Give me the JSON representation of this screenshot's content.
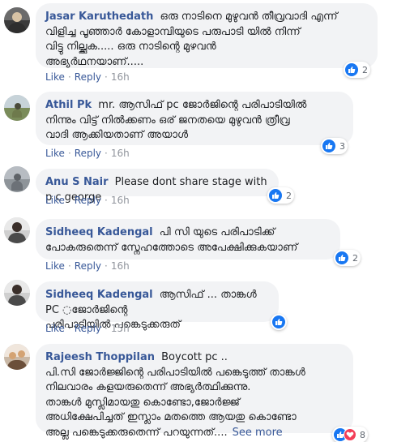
{
  "comments": [
    {
      "author": "Jasar Karuthedath",
      "text": "ഒരു നാടിനെ മുഴുവൻ തീവ്രവാദി എന്ന്\nവിളിച്ച പൂഞ്ഞാർ കോളാമ്പിയുടെ പരുപാടി യിൽ നിന്ന്\nവിട്ടു നില്ക്കുക..... ഒരു നാടിന്റെ മുഴവൻ\nഅഭ്യർഥനയാണ്.....",
      "reactions": [
        "like"
      ],
      "reaction_count": "2",
      "like_label": "Like",
      "reply_label": "Reply",
      "time": "16h",
      "avatar_colors": [
        "#6b6b6b",
        "#3b3b3b",
        "#d8c3a5",
        "#2e2e2e"
      ]
    },
    {
      "author": "Athil Pk",
      "text": "mr. ആസിഫ് pc ജോർജിന്റെ പരിപാടിയിൽ\nനിന്നും വിട്ട് നിൽക്കണം ഒര് ജനതയെ മുഴുവൻ ത്രീവ്ര\nവാദി ആക്കിയതാണ് അയാൾ",
      "reactions": [
        "like"
      ],
      "reaction_count": "3",
      "like_label": "Like",
      "reply_label": "Reply",
      "time": "16h",
      "avatar_colors": [
        "#c7d3d9",
        "#7a8c5a",
        "#4a4a3a",
        "#6e7a4c"
      ]
    },
    {
      "author": "Anu S Nair",
      "text": "Please dont share stage with p c george",
      "reactions": [
        "like"
      ],
      "reaction_count": "2",
      "like_label": "Like",
      "reply_label": "Reply",
      "time": "16h",
      "avatar_colors": [
        "#b7bcc2",
        "#8e9499",
        "#5f6368",
        "#6c7177"
      ]
    },
    {
      "author": "Sidheeq Kadengal",
      "text": "പി സി യുടെ പരിപാടിക്ക്\nപോകരുതെന്ന് സ്നേഹത്തോടെ അപേക്ഷിക്കുകയാണ്",
      "reactions": [
        "like"
      ],
      "reaction_count": "2",
      "like_label": "Like",
      "reply_label": "Reply",
      "time": "16h",
      "avatar_colors": [
        "#e9e9e9",
        "#cfcfcf",
        "#3a2f2a",
        "#4a4a4a"
      ]
    },
    {
      "author": "Sidheeq Kadengal",
      "text": "ആസിഫ് ... താങ്കൾ PC ◌ജോർജിന്റെ\nപരിപാടിയിൽ പങ്കെടുക്കരുത്",
      "reactions": [
        "like"
      ],
      "reaction_count": "",
      "like_label": "Like",
      "reply_label": "Reply",
      "time": "15h",
      "avatar_colors": [
        "#e9e9e9",
        "#cfcfcf",
        "#3a2f2a",
        "#4a4a4a"
      ]
    },
    {
      "author": "Rajeesh Thoppilan",
      "text": "Boycott pc ..\nപി.സി ജോർജ്ജിന്റെ പരിപാടിയിൽ പങ്കെടുത്ത് താങ്കൾ\nനിലവാരം കളയരുതെന്ന് അഭ്യർത്ഥിക്കുന്നു.\nതാങ്കൾ മുസ്ലിമായതു കൊണ്ടോ,ജോർജ്ജ്\nഅധിക്ഷേപിച്ചത് ഇസ്ലാം മതത്തെ ആയതു കൊണ്ടോ\nഅല്ല പങ്കെടുക്കരുതെന്ന് പറയുന്നത്....",
      "see_more": "See more",
      "reactions": [
        "like",
        "love"
      ],
      "reaction_count": "8",
      "like_label": "Like",
      "reply_label": "Reply",
      "time": "",
      "avatar_colors": [
        "#f0e6dc",
        "#c9b8a6",
        "#d4a373",
        "#6b4f3a"
      ]
    }
  ],
  "colors": {
    "author": "#385898",
    "bubble": "#f2f3f5",
    "meta": "#90949c",
    "like_blue": "#1877f2",
    "love_red": "#f33e58"
  }
}
